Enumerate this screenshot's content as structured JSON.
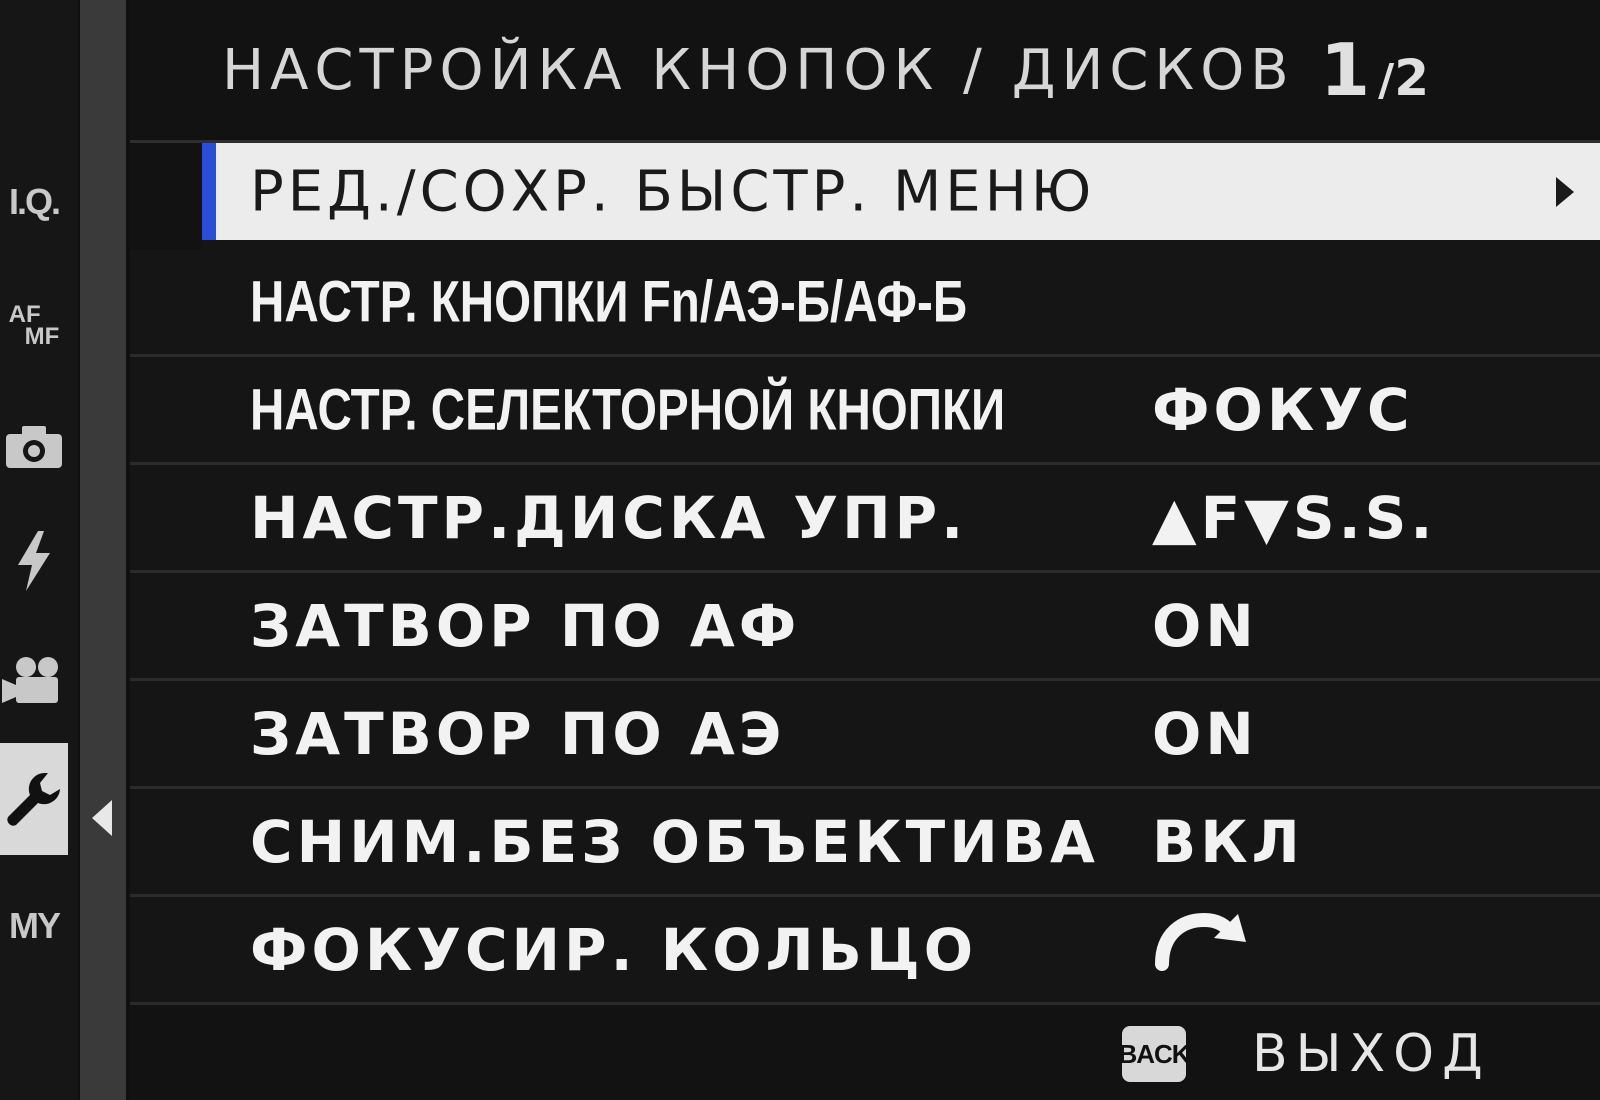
{
  "header": {
    "title": "НАСТРОЙКА КНОПОК / ДИСКОВ",
    "page_current": "1",
    "page_separator": "/",
    "page_total": "2"
  },
  "tabs": [
    {
      "label": "I.Q.",
      "icon": "image-quality-icon"
    },
    {
      "label_line1": "AF",
      "label_line2": "MF",
      "icon": "af-mf-icon"
    },
    {
      "icon": "camera-icon"
    },
    {
      "icon": "flash-icon"
    },
    {
      "icon": "movie-camera-icon"
    },
    {
      "icon": "wrench-icon",
      "active": true
    },
    {
      "label": "MY",
      "icon": "my-menu-icon"
    }
  ],
  "menu": {
    "items": [
      {
        "label": "РЕД./СОХР. БЫСТР. МЕНЮ",
        "value": "",
        "selected": true
      },
      {
        "label": "НАСТР. КНОПКИ Fn/АЭ-Б/АФ-Б",
        "value": ""
      },
      {
        "label": "НАСТР. СЕЛЕКТОРНОЙ КНОПКИ",
        "value": "ФОКУС"
      },
      {
        "label": "НАСТР.ДИСКА УПР.",
        "value": "▲F▼S.S."
      },
      {
        "label": "ЗАТВОР ПО АФ",
        "value": "ON"
      },
      {
        "label": "ЗАТВОР ПО АЭ",
        "value": "ON"
      },
      {
        "label": "СНИМ.БЕЗ ОБЪЕКТИВА",
        "value": "ВКЛ"
      },
      {
        "label": "ФОКУСИР. КОЛЬЦО",
        "value_icon": "clockwise-arrow-icon"
      }
    ]
  },
  "footer": {
    "back_key": "BACK",
    "exit_label": "ВЫХОД"
  },
  "colors": {
    "selection_accent": "#2a4fd6",
    "selection_background": "#ececec",
    "background": "#121212"
  }
}
